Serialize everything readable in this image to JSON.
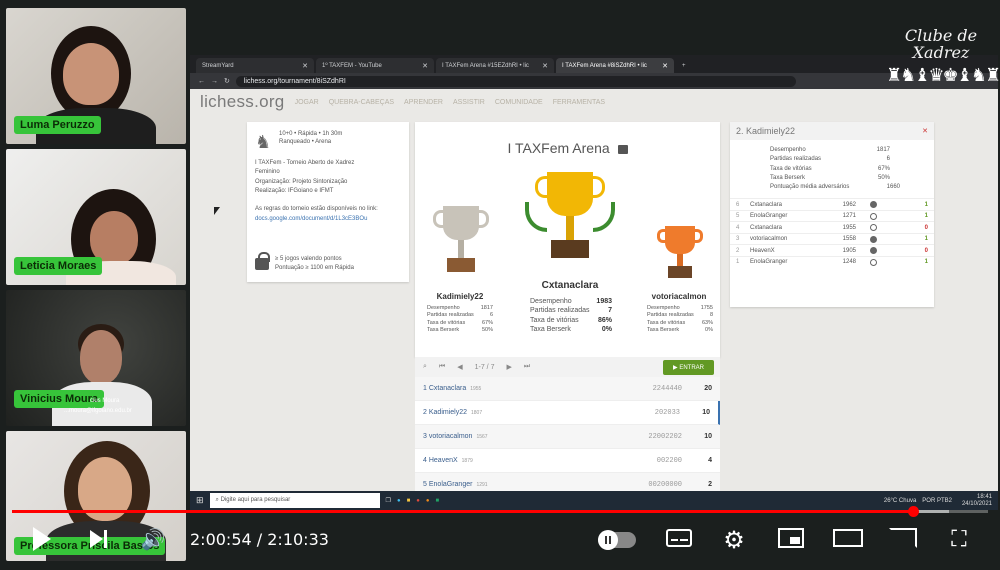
{
  "participants": [
    {
      "name": "Luma Peruzzo"
    },
    {
      "name": "Leticia Moraes"
    },
    {
      "name": "Vinicius Moura",
      "sub_name": "cius Moura",
      "email": "...moura@ifgoiano.edu.br"
    },
    {
      "name": "Professora Priscila Bastos"
    }
  ],
  "browser": {
    "tabs": [
      {
        "label": "StreamYard",
        "active": false
      },
      {
        "label": "1º TAXFEM - YouTube",
        "active": false
      },
      {
        "label": "I TAXFem Arena #15EZdhRI • lic",
        "active": false
      },
      {
        "label": "I TAXFem Arena #8iSZdhRI • lic",
        "active": true
      }
    ],
    "url": "lichess.org/tournament/8iSZdhRI"
  },
  "site": {
    "logo": "lichess.org",
    "nav": [
      "JOGAR",
      "QUEBRA-CABEÇAS",
      "APRENDER",
      "ASSISTIR",
      "COMUNIDADE",
      "FERRAMENTAS"
    ]
  },
  "tournament": {
    "format": "10+0 • Rápida • 1h 30m",
    "type": "Ranqueado • Arena",
    "description": [
      "I TAXFem - Torneio Aberto de Xadrez",
      "Feminino",
      "Organização: Projeto Sintonização",
      "Realização: IFGoiano e IFMT"
    ],
    "rules_text": "As regras do torneio estão disponíveis no link:",
    "rules_link": "docs.google.com/document/d/1L3cE3BOu",
    "conditions": [
      "≥ 5 jogos valendo pontos",
      "Pontuação ≥ 1100 em Rápida"
    ],
    "title": "I TAXFem Arena"
  },
  "podium": {
    "first": {
      "name": "Cxtanaclara",
      "stats": [
        [
          "Desempenho",
          "1983"
        ],
        [
          "Partidas realizadas",
          "7"
        ],
        [
          "Taxa de vitórias",
          "86%"
        ],
        [
          "Taxa Berserk",
          "0%"
        ]
      ]
    },
    "second": {
      "name": "Kadimiely22",
      "stats": [
        [
          "Desempenho",
          "1817"
        ],
        [
          "Partidas realizadas",
          "6"
        ],
        [
          "Taxa de vitórias",
          "67%"
        ],
        [
          "Taxa Berserk",
          "50%"
        ]
      ]
    },
    "third": {
      "name": "votoriacalmon",
      "stats": [
        [
          "Desempenho",
          "1755"
        ],
        [
          "Partidas realizadas",
          "8"
        ],
        [
          "Taxa de vitórias",
          "63%"
        ],
        [
          "Taxa Berserk",
          "0%"
        ]
      ]
    }
  },
  "controls": {
    "page": "1-7 / 7",
    "join": "ENTRAR"
  },
  "standings": [
    {
      "rank": "1",
      "name": "Cxtanaclara",
      "rating": "1955",
      "sheet": "2244440",
      "score": "20"
    },
    {
      "rank": "2",
      "name": "Kadimiely22",
      "rating": "1807",
      "sheet": "202033",
      "score": "10"
    },
    {
      "rank": "3",
      "name": "votoriacalmon",
      "rating": "1567",
      "sheet": "22002202",
      "score": "10"
    },
    {
      "rank": "4",
      "name": "HeavenX",
      "rating": "1879",
      "sheet": "002200",
      "score": "4"
    },
    {
      "rank": "5",
      "name": "EnolaGranger",
      "rating": "1291",
      "sheet": "00200000",
      "score": "2"
    }
  ],
  "player_panel": {
    "title": "2. Kadimiely22",
    "stats": [
      [
        "Desempenho",
        "1817"
      ],
      [
        "Partidas realizadas",
        "6"
      ],
      [
        "Taxa de vitórias",
        "67%"
      ],
      [
        "Taxa Berserk",
        "50%"
      ],
      [
        "Pontuação média adversários",
        "1660"
      ]
    ],
    "games": [
      {
        "n": "6",
        "opp": "Cxtanaclara",
        "rating": "1962",
        "color": "black",
        "result": "1"
      },
      {
        "n": "5",
        "opp": "EnolaGranger",
        "rating": "1271",
        "color": "white",
        "result": "1"
      },
      {
        "n": "4",
        "opp": "Cxtanaclara",
        "rating": "1955",
        "color": "white",
        "result": "0"
      },
      {
        "n": "3",
        "opp": "votoriacalmon",
        "rating": "1558",
        "color": "black",
        "result": "1"
      },
      {
        "n": "2",
        "opp": "HeavenX",
        "rating": "1905",
        "color": "black",
        "result": "0"
      },
      {
        "n": "1",
        "opp": "EnolaGranger",
        "rating": "1248",
        "color": "white",
        "result": "1"
      }
    ]
  },
  "watermark": {
    "line1": "Clube de",
    "line2": "Xadrez"
  },
  "taskbar": {
    "search": "Digite aqui para pesquisar",
    "weather": "26°C Chuva",
    "lang": "POR PTB2",
    "time": "18:41",
    "date": "24/10/2021"
  },
  "player": {
    "current": "2:00:54",
    "duration": "2:10:33",
    "time_display": "2:00:54 / 2:10:33",
    "progress_fraction": 0.923
  }
}
